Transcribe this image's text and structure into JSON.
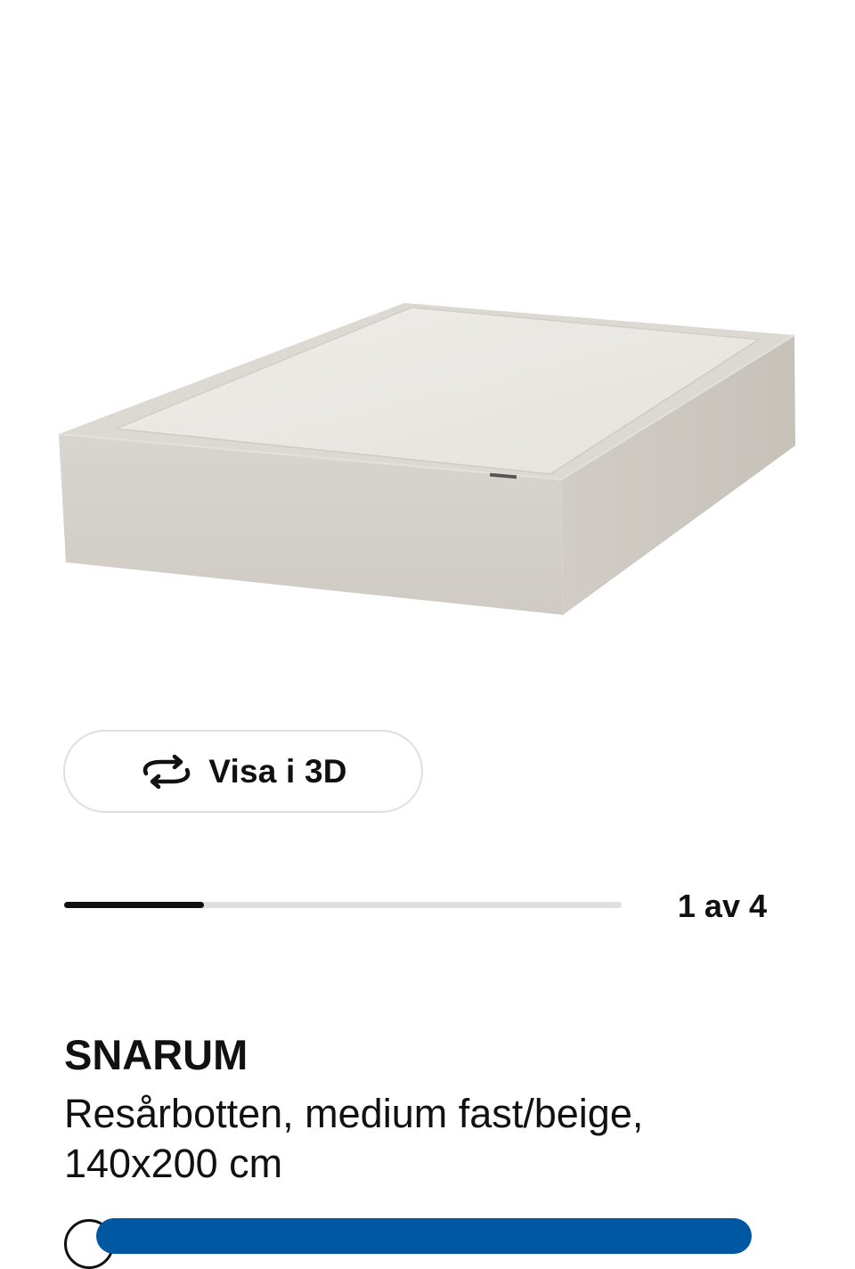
{
  "gallery": {
    "product_image": "box-spring-mattress-beige",
    "view_3d_label": "Visa i 3D",
    "view_3d_icon": "rotate-3d-icon",
    "current_index": 1,
    "total": 4,
    "counter_text": "1 av 4",
    "progress_fraction": 0.25
  },
  "product": {
    "name": "SNARUM",
    "description": "Resårbotten, medium fast/beige, 140x200 cm"
  },
  "colors": {
    "accent": "#0058a3",
    "text": "#111111",
    "border": "#dfdfdf",
    "track": "#dfdfdf"
  }
}
